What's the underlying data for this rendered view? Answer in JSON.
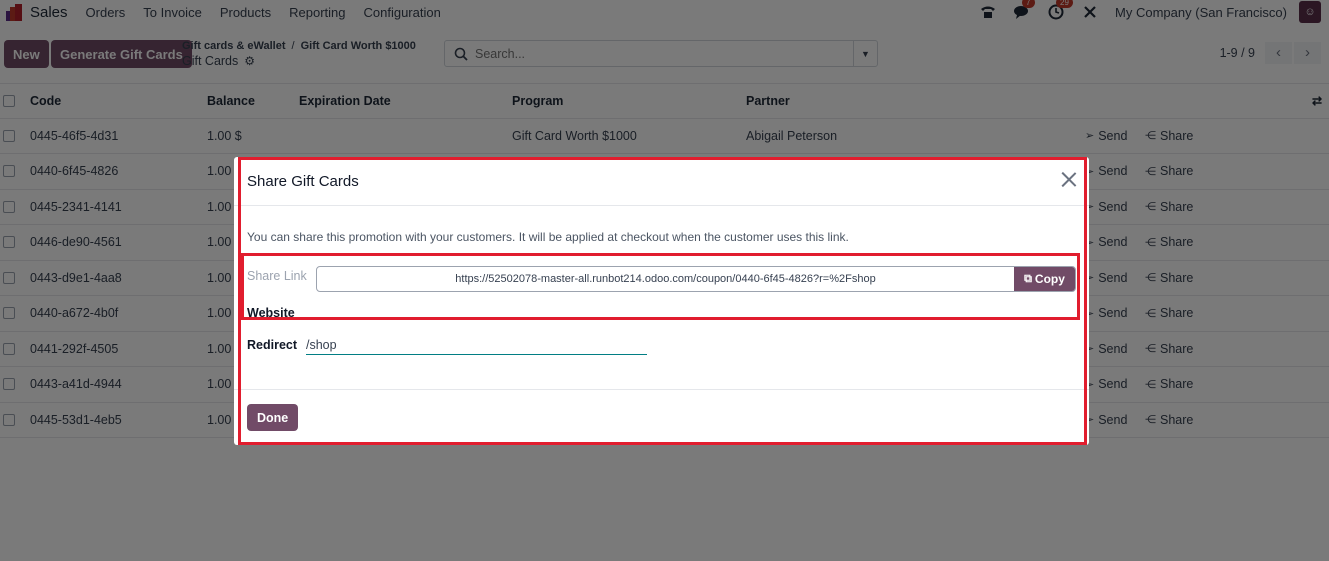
{
  "navbar": {
    "app_name": "Sales",
    "menu": [
      "Orders",
      "To Invoice",
      "Products",
      "Reporting",
      "Configuration"
    ],
    "messages_badge": "7",
    "activities_badge": "29",
    "company": "My Company (San Francisco)"
  },
  "control_panel": {
    "new_label": "New",
    "generate_label": "Generate Gift Cards",
    "breadcrumb": [
      "Gift cards & eWallet",
      "Gift Card Worth $1000"
    ],
    "breadcrumb_separator": "/",
    "current_view": "Gift Cards",
    "search_placeholder": "Search...",
    "pager_value": "1-9 / 9"
  },
  "list": {
    "columns": [
      "Code",
      "Balance",
      "Expiration Date",
      "Program",
      "Partner"
    ],
    "send_label": "Send",
    "share_label": "Share",
    "rows": [
      {
        "code": "0445-46f5-4d31",
        "balance": "1.00 $",
        "expiration": "",
        "program": "Gift Card Worth $1000",
        "partner": "Abigail Peterson"
      },
      {
        "code": "0440-6f45-4826",
        "balance": "1.00",
        "expiration": "",
        "program": "",
        "partner": ""
      },
      {
        "code": "0445-2341-4141",
        "balance": "1.00",
        "expiration": "",
        "program": "",
        "partner": ""
      },
      {
        "code": "0446-de90-4561",
        "balance": "1.00",
        "expiration": "",
        "program": "",
        "partner": ""
      },
      {
        "code": "0443-d9e1-4aa8",
        "balance": "1.00",
        "expiration": "",
        "program": "",
        "partner": ""
      },
      {
        "code": "0440-a672-4b0f",
        "balance": "1.00",
        "expiration": "",
        "program": "",
        "partner": ""
      },
      {
        "code": "0441-292f-4505",
        "balance": "1.00",
        "expiration": "",
        "program": "",
        "partner": ""
      },
      {
        "code": "0443-a41d-4944",
        "balance": "1.00",
        "expiration": "",
        "program": "",
        "partner": ""
      },
      {
        "code": "0445-53d1-4eb5",
        "balance": "1.00",
        "expiration": "",
        "program": "",
        "partner": ""
      }
    ]
  },
  "modal": {
    "title": "Share Gift Cards",
    "description": "You can share this promotion with your customers. It will be applied at checkout when the customer uses this link.",
    "share_link_label": "Share Link",
    "share_link_value": "https://52502078-master-all.runbot214.odoo.com/coupon/0440-6f45-4826?r=%2Fshop",
    "copy_label": "Copy",
    "website_label": "Website",
    "redirect_label": "Redirect",
    "redirect_value": "/shop",
    "done_label": "Done"
  },
  "colors": {
    "brand": "#714B67",
    "annotation": "#e11d2e",
    "badge": "#c0392b"
  }
}
